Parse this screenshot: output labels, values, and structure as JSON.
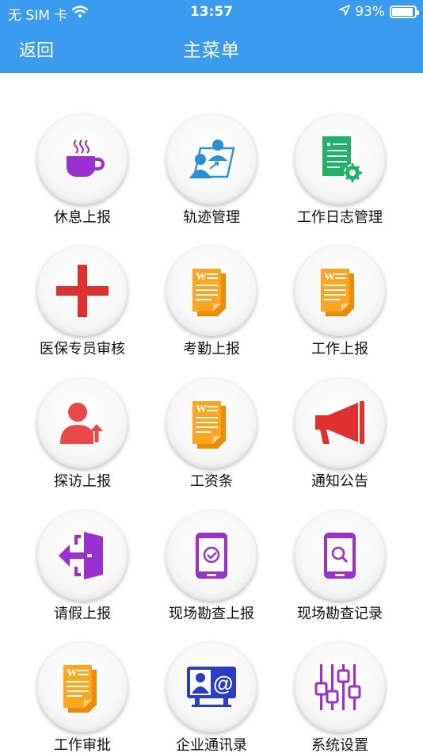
{
  "status_bar": {
    "carrier": "无 SIM 卡",
    "time": "13:57",
    "battery": "93%",
    "battery_level": 0.93
  },
  "nav": {
    "back_label": "返回",
    "title": "主菜单"
  },
  "menu": [
    {
      "label": "休息上报",
      "icon": "coffee-cup-icon"
    },
    {
      "label": "轨迹管理",
      "icon": "presentation-people-icon"
    },
    {
      "label": "工作日志管理",
      "icon": "document-settings-icon"
    },
    {
      "label": "医保专员审核",
      "icon": "red-cross-icon"
    },
    {
      "label": "考勤上报",
      "icon": "word-document-icon"
    },
    {
      "label": "工作上报",
      "icon": "word-document-icon"
    },
    {
      "label": "探访上报",
      "icon": "person-upload-icon"
    },
    {
      "label": "工资条",
      "icon": "word-document-icon"
    },
    {
      "label": "通知公告",
      "icon": "megaphone-icon"
    },
    {
      "label": "请假上报",
      "icon": "exit-door-icon"
    },
    {
      "label": "现场勘查上报",
      "icon": "phone-check-icon"
    },
    {
      "label": "现场勘查记录",
      "icon": "phone-search-icon"
    },
    {
      "label": "工作审批",
      "icon": "word-document-icon"
    },
    {
      "label": "企业通讯录",
      "icon": "contact-card-icon"
    },
    {
      "label": "系统设置",
      "icon": "sliders-icon"
    }
  ],
  "colors": {
    "header": "#3b9bef",
    "purple": "#9b2fd1",
    "red": "#e02f2f",
    "orange": "#ff9b1a",
    "green": "#1fb36a"
  }
}
